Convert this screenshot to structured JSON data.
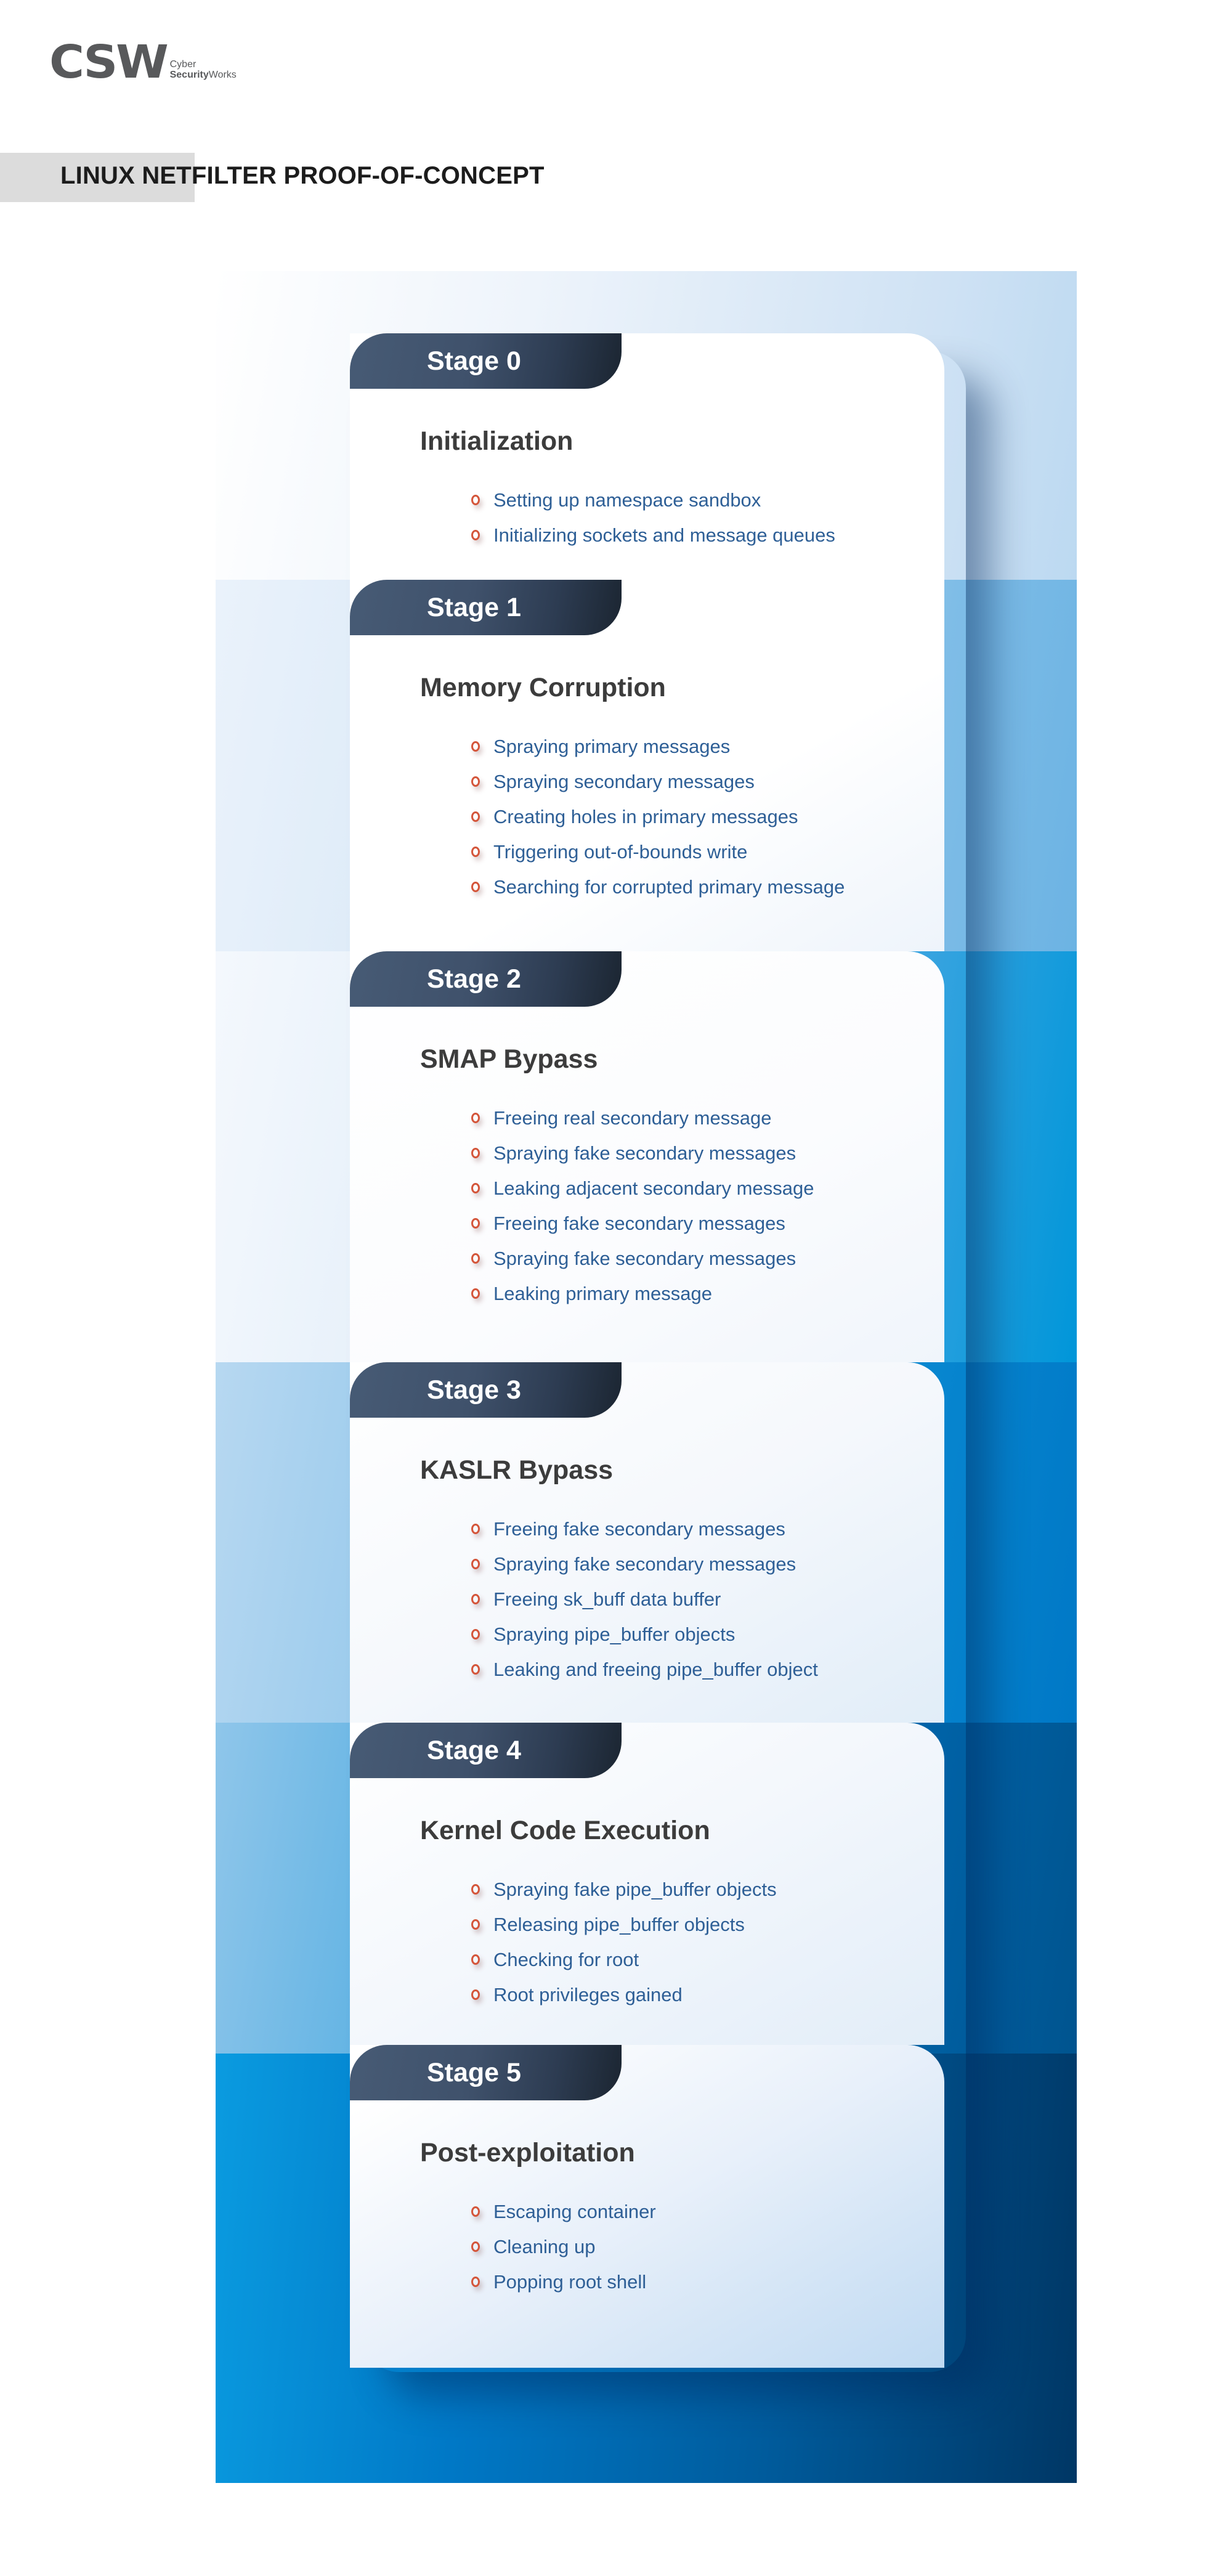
{
  "logo": {
    "mark": "CSW",
    "line1": "Cyber",
    "line2_bold": "Security",
    "line2_regular": "Works"
  },
  "page_title": "LINUX NETFILTER PROOF-OF-CONCEPT",
  "colors": {
    "header_dark": "#1b2531",
    "header_light": "#475b75",
    "heading_text": "#3c3c3c",
    "step_text": "#2e5f96",
    "bullet_ring": "#d4553a"
  },
  "stages": [
    {
      "label": "Stage 0",
      "title": "Initialization",
      "steps": [
        "Setting up namespace sandbox",
        "Initializing sockets and message queues"
      ]
    },
    {
      "label": "Stage 1",
      "title": "Memory Corruption",
      "steps": [
        "Spraying primary messages",
        "Spraying secondary messages",
        "Creating holes in primary messages",
        "Triggering out-of-bounds write",
        "Searching for corrupted primary message"
      ]
    },
    {
      "label": "Stage 2",
      "title": "SMAP Bypass",
      "steps": [
        "Freeing real secondary message",
        "Spraying fake secondary messages",
        "Leaking adjacent secondary message",
        "Freeing fake secondary messages",
        "Spraying fake secondary messages",
        "Leaking primary message"
      ]
    },
    {
      "label": "Stage 3",
      "title": "KASLR Bypass",
      "steps": [
        "Freeing fake secondary messages",
        "Spraying fake secondary messages",
        "Freeing sk_buff data buffer",
        "Spraying pipe_buffer objects",
        "Leaking and freeing pipe_buffer object"
      ]
    },
    {
      "label": "Stage 4",
      "title": "Kernel Code Execution",
      "steps": [
        "Spraying fake pipe_buffer objects",
        "Releasing pipe_buffer objects",
        "Checking for root",
        "Root privileges gained"
      ]
    },
    {
      "label": "Stage 5",
      "title": "Post-exploitation",
      "steps": [
        "Escaping container",
        "Cleaning up",
        "Popping root shell"
      ]
    }
  ]
}
